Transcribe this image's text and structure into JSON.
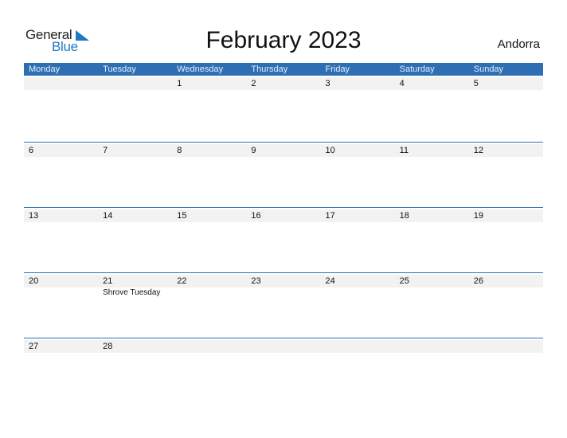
{
  "logo": {
    "general": "General",
    "blue": "Blue"
  },
  "title": "February 2023",
  "country": "Andorra",
  "weekdays": [
    "Monday",
    "Tuesday",
    "Wednesday",
    "Thursday",
    "Friday",
    "Saturday",
    "Sunday"
  ],
  "weeks": [
    {
      "days": [
        "",
        "",
        "1",
        "2",
        "3",
        "4",
        "5"
      ],
      "events": [
        "",
        "",
        "",
        "",
        "",
        "",
        ""
      ]
    },
    {
      "days": [
        "6",
        "7",
        "8",
        "9",
        "10",
        "11",
        "12"
      ],
      "events": [
        "",
        "",
        "",
        "",
        "",
        "",
        ""
      ]
    },
    {
      "days": [
        "13",
        "14",
        "15",
        "16",
        "17",
        "18",
        "19"
      ],
      "events": [
        "",
        "",
        "",
        "",
        "",
        "",
        ""
      ]
    },
    {
      "days": [
        "20",
        "21",
        "22",
        "23",
        "24",
        "25",
        "26"
      ],
      "events": [
        "",
        "Shrove Tuesday",
        "",
        "",
        "",
        "",
        ""
      ]
    },
    {
      "days": [
        "27",
        "28",
        "",
        "",
        "",
        "",
        ""
      ],
      "events": [
        "",
        "",
        "",
        "",
        "",
        "",
        ""
      ]
    }
  ],
  "colors": {
    "header": "#2e6fb4",
    "brand_blue": "#1f7ac4",
    "strip": "#f2f2f2"
  }
}
